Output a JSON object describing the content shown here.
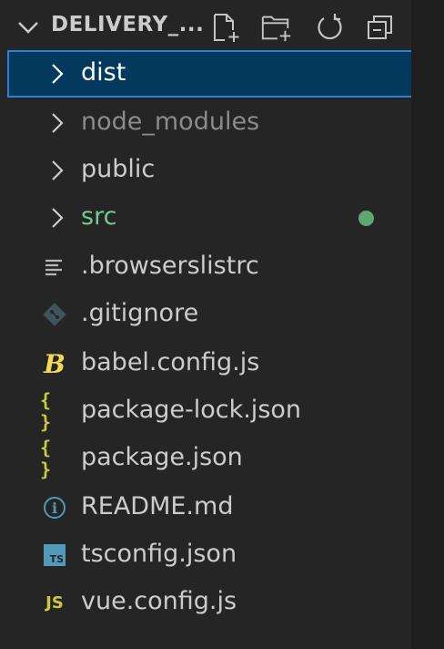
{
  "explorer": {
    "title": "DELIVERY_...",
    "actions": {
      "new_file_icon": "new-file-icon",
      "new_folder_icon": "new-folder-icon",
      "refresh_icon": "refresh-icon",
      "collapse_icon": "collapse-all-icon"
    },
    "items": [
      {
        "label": "dist",
        "kind": "folder",
        "selected": true
      },
      {
        "label": "node_modules",
        "kind": "folder",
        "dimmed": true
      },
      {
        "label": "public",
        "kind": "folder"
      },
      {
        "label": "src",
        "kind": "folder",
        "modified": true
      },
      {
        "label": ".browserslistrc",
        "kind": "file",
        "icon": "lines-icon"
      },
      {
        "label": ".gitignore",
        "kind": "file",
        "icon": "git-icon"
      },
      {
        "label": "babel.config.js",
        "kind": "file",
        "icon": "babel-icon",
        "icon_text": "B"
      },
      {
        "label": "package-lock.json",
        "kind": "file",
        "icon": "json-icon",
        "icon_text": "{ }"
      },
      {
        "label": "package.json",
        "kind": "file",
        "icon": "json-icon",
        "icon_text": "{ }"
      },
      {
        "label": "README.md",
        "kind": "file",
        "icon": "info-icon",
        "icon_text": "i"
      },
      {
        "label": "tsconfig.json",
        "kind": "file",
        "icon": "ts-icon",
        "icon_text": "TS"
      },
      {
        "label": "vue.config.js",
        "kind": "file",
        "icon": "js-icon",
        "icon_text": "JS"
      }
    ]
  },
  "colors": {
    "background": "#252526",
    "selected_background": "#04395e",
    "selected_border": "#2f80d1",
    "text": "#cccccc",
    "dimmed_text": "#8b8b8b",
    "modified_text": "#73c991",
    "modified_dot": "#5fa772",
    "json_icon": "#cbcb41",
    "babel_icon": "#f5da55",
    "js_icon": "#cbcb41",
    "ts_icon": "#519aba",
    "info_icon": "#519aba",
    "git_icon": "#41535b"
  }
}
